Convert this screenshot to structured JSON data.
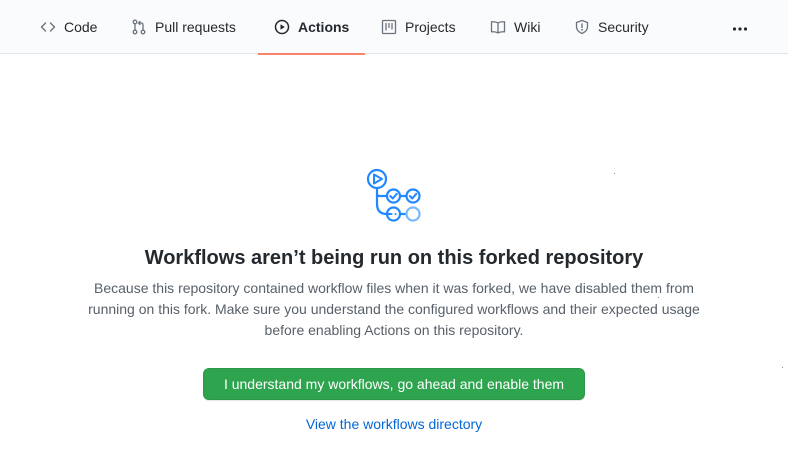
{
  "tabs": [
    {
      "label": "Code",
      "icon": "code-icon",
      "selected": false
    },
    {
      "label": "Pull requests",
      "icon": "git-pull-request-icon",
      "selected": false
    },
    {
      "label": "Actions",
      "icon": "play-icon",
      "selected": true
    },
    {
      "label": "Projects",
      "icon": "project-icon",
      "selected": false
    },
    {
      "label": "Wiki",
      "icon": "book-icon",
      "selected": false
    },
    {
      "label": "Security",
      "icon": "shield-icon",
      "selected": false
    }
  ],
  "more_menu_icon": "kebab-horizontal-icon",
  "blankslate": {
    "illustration_icon": "workflow-icon",
    "title": "Workflows aren’t being run on this forked repository",
    "description": "Because this repository contained workflow files when it was forked, we have disabled them from running on this fork. Make sure you understand the configured workflows and their expected usage before enabling Actions on this repository.",
    "enable_button": "I understand my workflows, go ahead and enable them",
    "directory_link": "View the workflows directory"
  },
  "colors": {
    "selected_tab_underline": "#f9826c",
    "primary_button": "#2ea44f",
    "link": "#0366d6",
    "illustration": "#2188ff"
  }
}
